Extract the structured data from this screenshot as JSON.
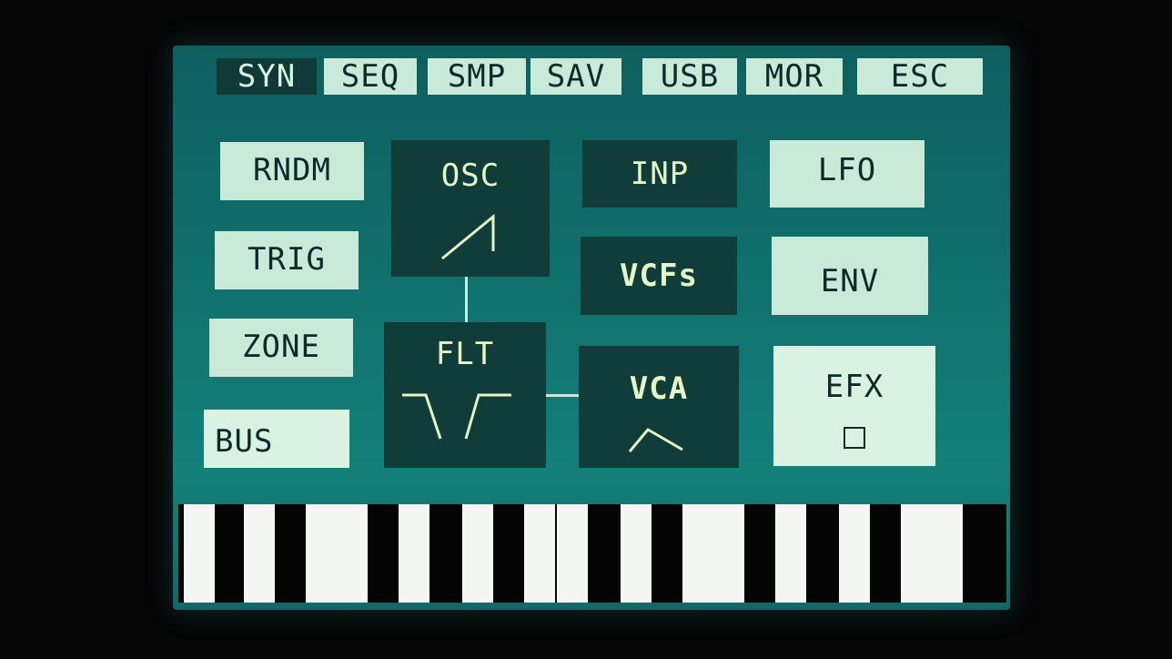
{
  "tabs": [
    {
      "label": "SYN",
      "active": true
    },
    {
      "label": "SEQ",
      "active": false
    },
    {
      "label": "SMP",
      "active": false
    },
    {
      "label": "SAV",
      "active": false
    },
    {
      "label": "USB",
      "active": false
    },
    {
      "label": "MOR",
      "active": false
    },
    {
      "label": "ESC",
      "active": false
    }
  ],
  "left_buttons": {
    "rndm": "RNDM",
    "trig": "TRIG",
    "zone": "ZONE",
    "bus": "BUS"
  },
  "signal_path": {
    "osc": {
      "label": "OSC",
      "icon": "sawtooth-wave-icon"
    },
    "flt": {
      "label": "FLT",
      "icon": "notch-filter-icon"
    },
    "vca": {
      "label": "VCA",
      "icon": "envelope-icon"
    }
  },
  "middle_buttons": {
    "inp": "INP",
    "vcfs": "VCFs"
  },
  "right_buttons": {
    "lfo": "LFO",
    "env": "ENV",
    "efx": {
      "label": "EFX",
      "icon": "checkbox-icon"
    }
  },
  "keyboard": {
    "white_keys": 15
  },
  "colors": {
    "screen": "#10706c",
    "light_button": "#c9ead9",
    "dark_button": "#103d3a",
    "dark_text": "#e6f5c6"
  }
}
